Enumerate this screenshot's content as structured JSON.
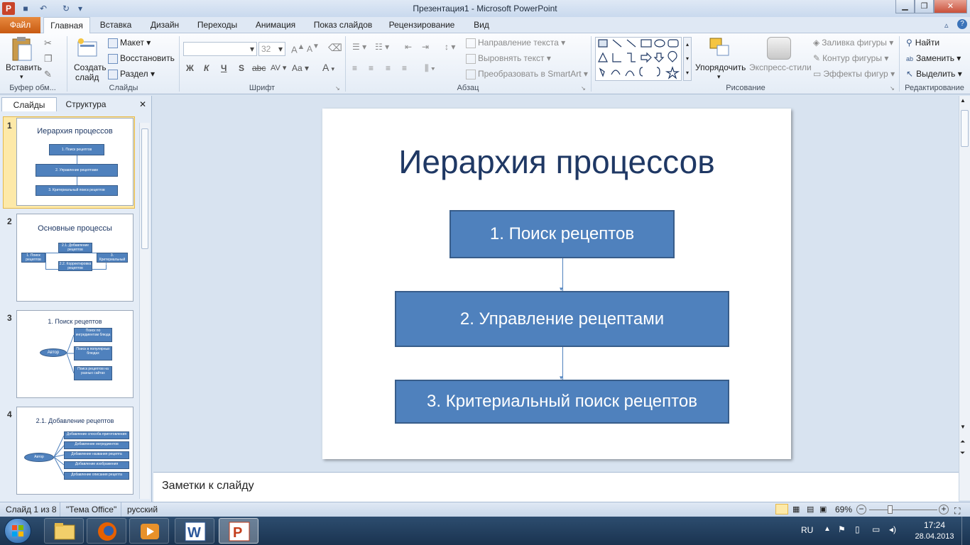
{
  "window": {
    "title": "Презентация1  -  Microsoft PowerPoint"
  },
  "tabs": [
    "Файл",
    "Главная",
    "Вставка",
    "Дизайн",
    "Переходы",
    "Анимация",
    "Показ слайдов",
    "Рецензирование",
    "Вид"
  ],
  "ribbon": {
    "clipboard": {
      "paste": "Вставить",
      "label": "Буфер обм..."
    },
    "slides": {
      "new_slide_1": "Создать",
      "new_slide_2": "слайд",
      "layout": "Макет",
      "reset": "Восстановить",
      "section": "Раздел",
      "label": "Слайды"
    },
    "font": {
      "size": "32",
      "label": "Шрифт",
      "bold": "Ж",
      "italic": "К",
      "underline": "Ч",
      "shadow": "S",
      "strike": "abc",
      "spacing": "AV",
      "case": "Aa",
      "color": "A"
    },
    "paragraph": {
      "direction": "Направление текста",
      "align": "Выровнять текст",
      "smartart": "Преобразовать в SmartArt",
      "label": "Абзац"
    },
    "drawing": {
      "arrange": "Упорядочить",
      "quick_styles": "Экспресс-стили",
      "fill": "Заливка фигуры",
      "outline": "Контур фигуры",
      "effects": "Эффекты фигур",
      "label": "Рисование"
    },
    "editing": {
      "find": "Найти",
      "replace": "Заменить",
      "select": "Выделить",
      "label": "Редактирование"
    }
  },
  "left_pane": {
    "tab_slides": "Слайды",
    "tab_outline": "Структура",
    "close": "✕",
    "thumbs": [
      {
        "num": "1",
        "title": "Иерархия процессов",
        "boxes": [
          "1. Поиск  рецептов",
          "2. Управление рецептами",
          "3. Критериальный поиск рецептов"
        ]
      },
      {
        "num": "2",
        "title": "Основные процессы",
        "boxes": [
          "2.1. Добавление рецептов",
          "1. Поиск рецептов",
          "2.2. Корректировка рецептов",
          "3. Критериальный поиск рецептов"
        ]
      },
      {
        "num": "3",
        "title": "1. Поиск рецептов",
        "boxes": [
          "Автор",
          "Поиск по ингредиентам блюда",
          "Поиск в популярных блюдах",
          "Поиск рецептов на разных сайтах"
        ]
      },
      {
        "num": "4",
        "title": "2.1. Добавление рецептов",
        "boxes": [
          "Автор",
          "Добавление способа приготовления",
          "Добавление ингредиентов",
          "Добавление названия рецепта",
          "Добавление изображения",
          "Добавление описания рецепта"
        ]
      }
    ]
  },
  "slide": {
    "title": "Иерархия процессов",
    "box1": "1. Поиск  рецептов",
    "box2": "2. Управление рецептами",
    "box3": "3. Критериальный поиск рецептов"
  },
  "notes": {
    "placeholder": "Заметки к слайду"
  },
  "status": {
    "slide": "Слайд 1 из 8",
    "theme": "\"Тема Office\"",
    "lang": "русский",
    "zoom": "69%"
  },
  "taskbar": {
    "lang": "RU",
    "time": "17:24",
    "date": "28.04.2013"
  },
  "colors": {
    "accent": "#4f81bd",
    "title": "#1f3864",
    "file_tab": "#d96b23"
  }
}
